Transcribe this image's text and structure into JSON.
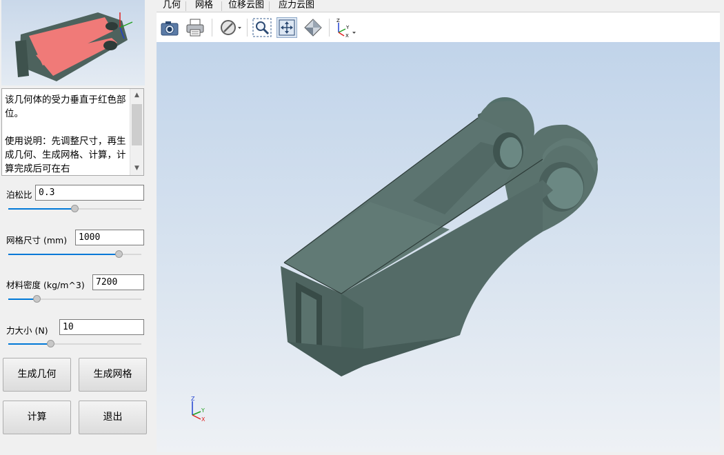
{
  "description": {
    "text": "该几何体的受力垂直于红色部位。\n\n使用说明：先调整尺寸，再生成几何、生成网格、计算，计算完成后可在右"
  },
  "params": [
    {
      "label": "泊松比",
      "value": "0.3",
      "fraction": 0.5
    },
    {
      "label": "网格尺寸 (mm)",
      "value": "1000",
      "fraction": 0.85
    },
    {
      "label": "材料密度 (kg/m^3)",
      "value": "7200",
      "fraction": 0.2
    },
    {
      "label": "力大小 (N)",
      "value": "10",
      "fraction": 0.31
    }
  ],
  "buttons": {
    "gen_geometry": "生成几何",
    "gen_mesh": "生成网格",
    "compute": "计算",
    "exit": "退出"
  },
  "menu": {
    "items": [
      "几何",
      "网格",
      "位移云图",
      "应力云图"
    ]
  },
  "toolbar": {
    "icons": [
      "camera-icon",
      "printer-icon",
      "section-view-icon",
      "zoom-window-icon",
      "fit-all-icon",
      "iso-view-icon",
      "axis-orientation-icon"
    ]
  },
  "axes": {
    "x": "X",
    "y": "Y",
    "z": "Z"
  },
  "colors": {
    "accent": "#0078d7",
    "model_body": "#5a706b",
    "highlight": "#f07070"
  }
}
